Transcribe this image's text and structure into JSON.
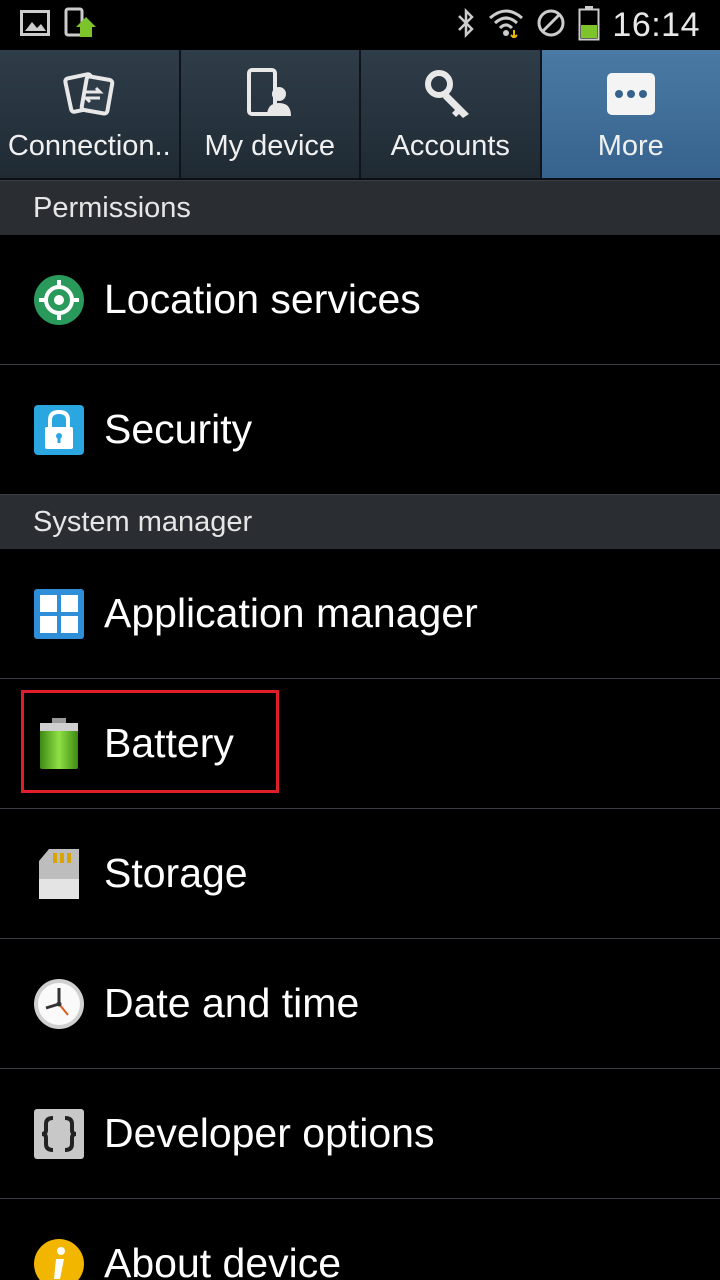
{
  "status_bar": {
    "time": "16:14",
    "icons": [
      "image-icon",
      "app-update-icon",
      "bluetooth-icon",
      "wifi-icon",
      "no-sim-icon",
      "battery-icon"
    ]
  },
  "tabs": [
    {
      "label": "Connection..",
      "icon": "connections-icon",
      "active": false
    },
    {
      "label": "My device",
      "icon": "my-device-icon",
      "active": false
    },
    {
      "label": "Accounts",
      "icon": "key-icon",
      "active": false
    },
    {
      "label": "More",
      "icon": "more-icon",
      "active": true
    }
  ],
  "sections": {
    "permissions": {
      "title": "Permissions",
      "items": [
        {
          "label": "Location services",
          "icon": "location-icon"
        },
        {
          "label": "Security",
          "icon": "lock-icon"
        }
      ]
    },
    "system_manager": {
      "title": "System manager",
      "items": [
        {
          "label": "Application manager",
          "icon": "grid-icon"
        },
        {
          "label": "Battery",
          "icon": "battery-icon",
          "highlighted": true
        },
        {
          "label": "Storage",
          "icon": "sd-card-icon"
        },
        {
          "label": "Date and time",
          "icon": "clock-icon"
        },
        {
          "label": "Developer options",
          "icon": "braces-icon"
        },
        {
          "label": "About device",
          "icon": "info-icon"
        }
      ]
    }
  },
  "colors": {
    "active_tab": "#4a7aa4",
    "highlight": "#e01e2a",
    "battery_green": "#6fc82d"
  }
}
